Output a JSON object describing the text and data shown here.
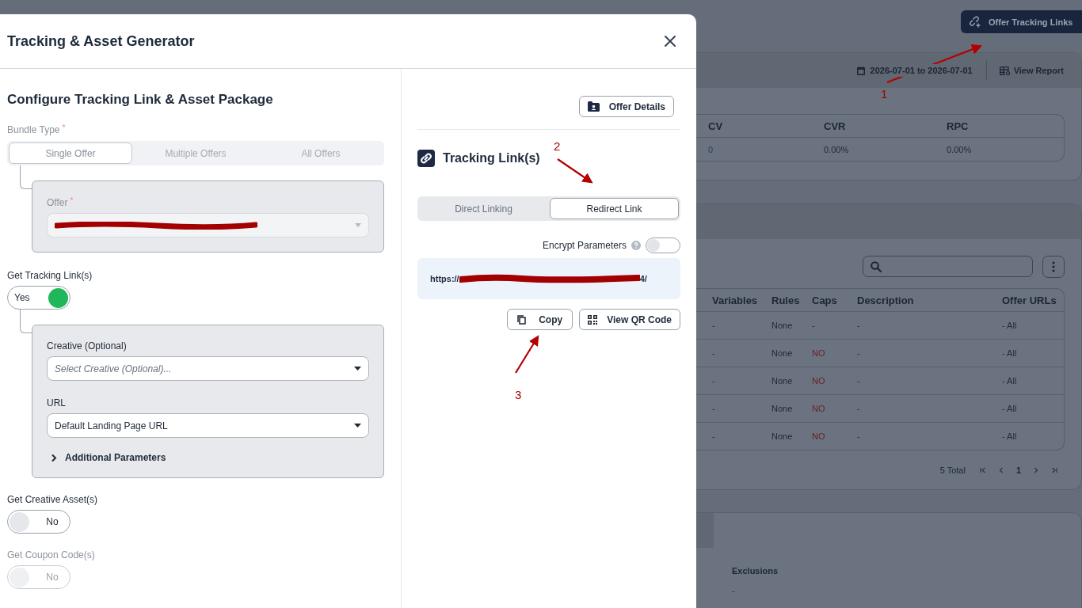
{
  "background": {
    "header_button": "Offer Tracking Links",
    "stats_card": {
      "date_range": "2026-07-01 to 2026-07-01",
      "view_report": "View Report",
      "columns": [
        "CV",
        "CVR",
        "RPC"
      ],
      "values": [
        {
          "text": "0",
          "kind": "link"
        },
        {
          "text": "0.00%",
          "kind": "plain"
        },
        {
          "text": "0.00%",
          "kind": "plain"
        }
      ]
    },
    "links_table": {
      "columns": [
        "Variables",
        "Rules",
        "Caps",
        "Description",
        "Offer URLs"
      ],
      "rows": [
        {
          "cells": [
            {
              "text": "-",
              "kind": "plain"
            },
            {
              "text": "None",
              "kind": "plain"
            },
            {
              "text": "-",
              "kind": "plain"
            },
            {
              "text": "-",
              "kind": "plain"
            },
            {
              "text": "- All",
              "kind": "plain"
            }
          ]
        },
        {
          "cells": [
            {
              "text": "-",
              "kind": "plain"
            },
            {
              "text": "None",
              "kind": "plain"
            },
            {
              "text": "NO",
              "kind": "negative"
            },
            {
              "text": "-",
              "kind": "plain"
            },
            {
              "text": "- All",
              "kind": "plain"
            }
          ]
        },
        {
          "cells": [
            {
              "text": "-",
              "kind": "plain"
            },
            {
              "text": "None",
              "kind": "plain"
            },
            {
              "text": "NO",
              "kind": "negative"
            },
            {
              "text": "-",
              "kind": "plain"
            },
            {
              "text": "- All",
              "kind": "plain"
            }
          ]
        },
        {
          "cells": [
            {
              "text": "-",
              "kind": "plain"
            },
            {
              "text": "None",
              "kind": "plain"
            },
            {
              "text": "NO",
              "kind": "negative"
            },
            {
              "text": "-",
              "kind": "plain"
            },
            {
              "text": "- All",
              "kind": "plain"
            }
          ]
        },
        {
          "cells": [
            {
              "text": "-",
              "kind": "plain"
            },
            {
              "text": "None",
              "kind": "plain"
            },
            {
              "text": "NO",
              "kind": "negative"
            },
            {
              "text": "-",
              "kind": "plain"
            },
            {
              "text": "- All",
              "kind": "plain"
            }
          ]
        }
      ],
      "total": "5 Total",
      "page": "1"
    },
    "exclusions": {
      "label": "Exclusions",
      "value": "-"
    }
  },
  "modal": {
    "title": "Tracking & Asset Generator",
    "left": {
      "heading": "Configure Tracking Link & Asset Package",
      "bundle_type": {
        "label": "Bundle Type",
        "required_mark": "*",
        "options": [
          {
            "label": "Single Offer",
            "selected": true
          },
          {
            "label": "Multiple Offers",
            "selected": false
          },
          {
            "label": "All Offers",
            "selected": false
          }
        ]
      },
      "offer": {
        "label": "Offer",
        "required_mark": "*",
        "redacted": true
      },
      "tracking_links": {
        "label": "Get Tracking Link(s)",
        "toggle": {
          "label": "Yes",
          "on": true,
          "disabled": false
        },
        "creative": {
          "label": "Creative (Optional)",
          "placeholder": "Select Creative (Optional)..."
        },
        "url": {
          "label": "URL",
          "value": "Default Landing Page URL"
        },
        "additional": {
          "label": "Additional Parameters",
          "expanded": false
        }
      },
      "creative_assets": {
        "label": "Get Creative Asset(s)",
        "toggle": {
          "label": "No",
          "on": false,
          "disabled": false
        }
      },
      "coupon_codes": {
        "label": "Get Coupon Code(s)",
        "toggle": {
          "label": "No",
          "on": false,
          "disabled": true
        }
      }
    },
    "right": {
      "offer_details": "Offer Details",
      "heading": "Tracking Link(s)",
      "link_types": [
        {
          "label": "Direct Linking",
          "selected": false
        },
        {
          "label": "Redirect Link",
          "selected": true
        }
      ],
      "encrypt": {
        "label": "Encrypt Parameters",
        "on": false
      },
      "link": {
        "text": "https://",
        "tail": "4/",
        "redacted": true
      },
      "copy": "Copy",
      "qr": "View QR Code"
    }
  },
  "annotations": [
    {
      "label": "1"
    },
    {
      "label": "2"
    },
    {
      "label": "3"
    }
  ]
}
